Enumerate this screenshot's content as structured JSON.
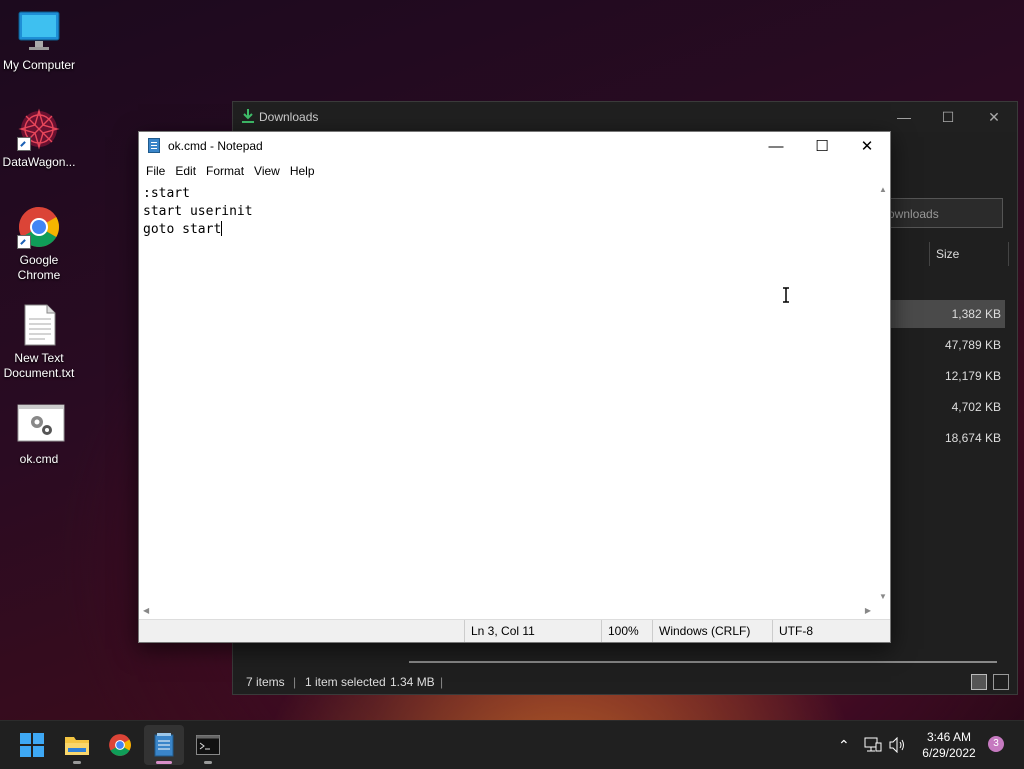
{
  "desktop": {
    "icons": [
      {
        "label": "My Computer"
      },
      {
        "label": "DataWagon..."
      },
      {
        "label": "Google Chrome"
      },
      {
        "label": "New Text Document.txt"
      },
      {
        "label": "ok.cmd"
      }
    ]
  },
  "explorer": {
    "title": "Downloads",
    "search_placeholder": "ownloads",
    "size_header": "Size",
    "sizes": [
      "1,382 KB",
      "47,789 KB",
      "12,179 KB",
      "4,702 KB",
      "18,674 KB"
    ],
    "status": {
      "items": "7 items",
      "selected": "1 item selected",
      "size": "1.34 MB",
      "sep": "|"
    }
  },
  "notepad": {
    "title": "ok.cmd - Notepad",
    "menus": [
      "File",
      "Edit",
      "Format",
      "View",
      "Help"
    ],
    "lines": [
      ":start",
      "start userinit",
      "goto start"
    ],
    "status": {
      "position": "Ln 3, Col 11",
      "zoom": "100%",
      "line_ending": "Windows (CRLF)",
      "encoding": "UTF-8"
    }
  },
  "taskbar": {
    "time": "3:46 AM",
    "date": "6/29/2022",
    "notifications": "3"
  },
  "colors": {
    "accent": "#d88fc9",
    "taskbar": "#202020",
    "explorer_bg": "#1f1f1f"
  }
}
